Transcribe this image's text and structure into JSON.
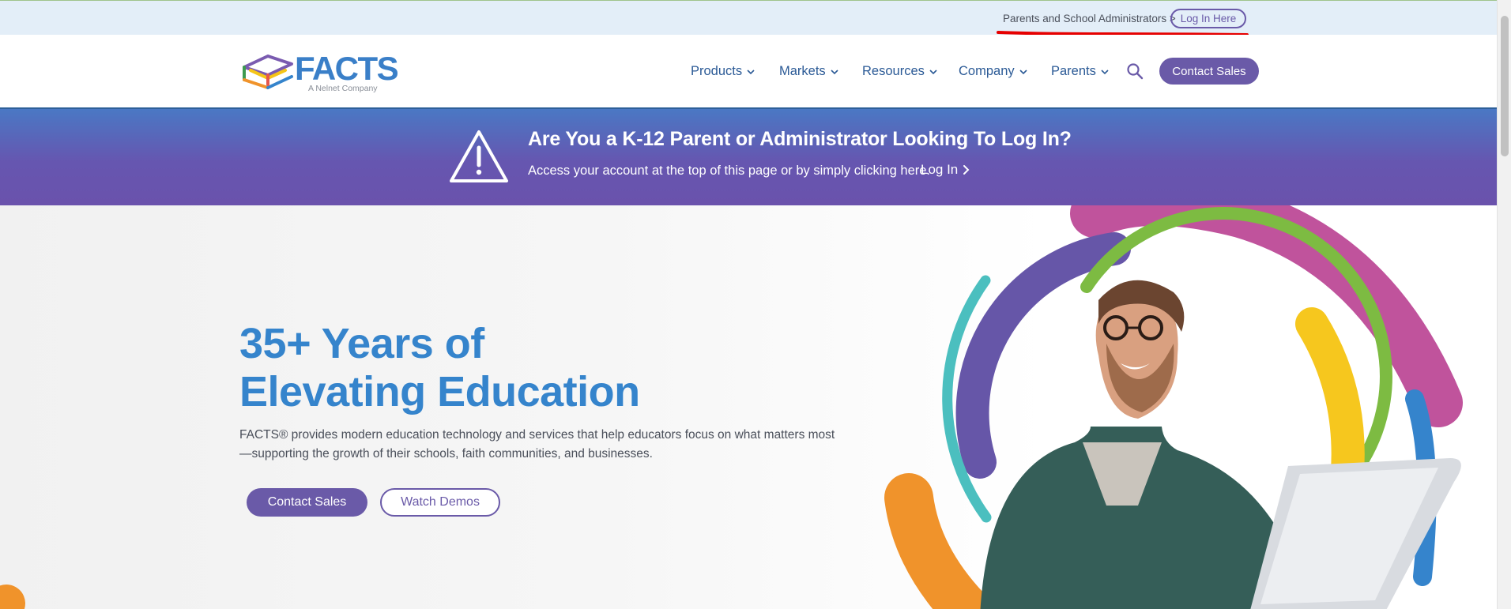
{
  "utility_bar": {
    "audience_text": "Parents and School Administrators >",
    "login_label": "Log In Here"
  },
  "header": {
    "logo_word": "FACTS",
    "logo_sub": "A Nelnet Company",
    "nav": [
      {
        "label": "Products"
      },
      {
        "label": "Markets"
      },
      {
        "label": "Resources"
      },
      {
        "label": "Company"
      },
      {
        "label": "Parents"
      }
    ],
    "contact_label": "Contact Sales"
  },
  "alert": {
    "title": "Are You a K-12 Parent or Administrator Looking To Log In?",
    "subtitle": "Access your account at the top of this page or by simply clicking here.",
    "link_label": "Log In"
  },
  "hero": {
    "title_line1": "35+ Years of",
    "title_line2": "Elevating Education",
    "description": "FACTS® provides modern education technology and services that help educators focus on what matters most—supporting the growth of their schools, faith communities, and businesses.",
    "primary_button": "Contact Sales",
    "secondary_button": "Watch Demos"
  },
  "colors": {
    "brand_purple": "#6a5aa8",
    "brand_blue": "#3584cc",
    "nav_text": "#2b5a96",
    "annotation_red": "#e60000"
  },
  "icons": [
    "search-icon",
    "chevron-down-icon",
    "chevron-right-icon",
    "warning-icon",
    "facts-logo-icon"
  ]
}
